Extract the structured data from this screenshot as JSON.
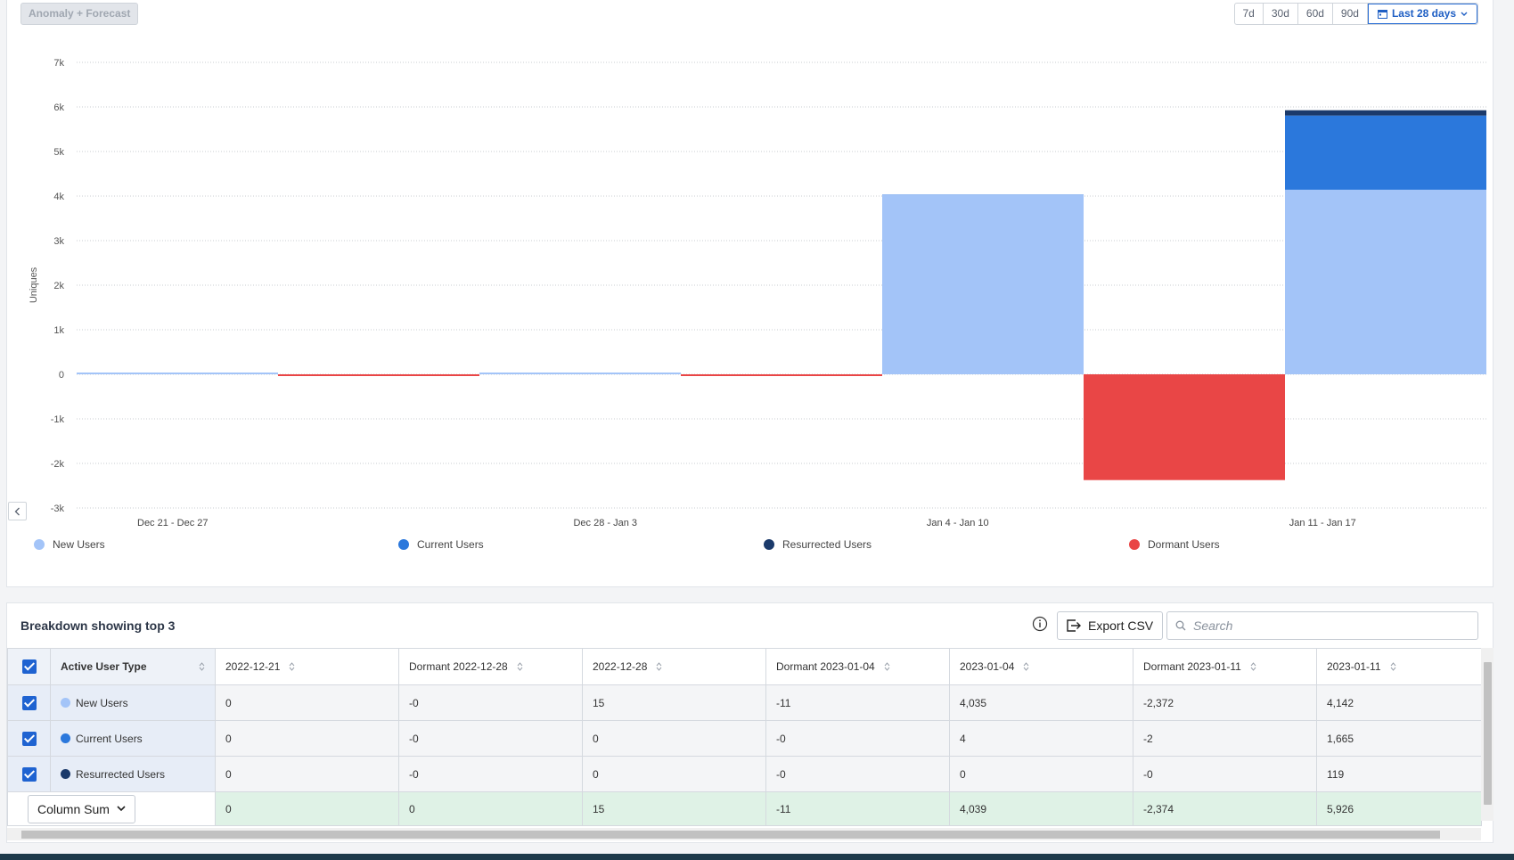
{
  "toolbar": {
    "anomaly_label": "Anomaly + Forecast",
    "ranges": [
      "7d",
      "30d",
      "60d",
      "90d"
    ],
    "active_range": "Last 28 days"
  },
  "chart_data": {
    "type": "bar",
    "stacked": true,
    "ylabel": "Uniques",
    "ylim": [
      -3000,
      7000
    ],
    "yticks": [
      7000,
      6000,
      5000,
      4000,
      3000,
      2000,
      1000,
      0,
      -1000,
      -2000,
      -3000
    ],
    "ytick_labels": [
      "7k",
      "6k",
      "5k",
      "4k",
      "3k",
      "2k",
      "1k",
      "0",
      "-1k",
      "-2k",
      "-3k"
    ],
    "grid": true,
    "legend_position": "bottom",
    "x_periods": [
      "Dec 21 - Dec 27",
      "Dec 28 - Jan 3",
      "Jan 4 - Jan 10",
      "Jan 11 - Jan 17"
    ],
    "bars": [
      {
        "period": 0,
        "dormant": false,
        "new": 0,
        "current": 0,
        "resurrected": 0
      },
      {
        "period": 0,
        "dormant": true,
        "value": 0
      },
      {
        "period": 1,
        "dormant": false,
        "new": 15,
        "current": 0,
        "resurrected": 0
      },
      {
        "period": 1,
        "dormant": true,
        "value": -11
      },
      {
        "period": 2,
        "dormant": false,
        "new": 4035,
        "current": 4,
        "resurrected": 0
      },
      {
        "period": 2,
        "dormant": true,
        "value": -2374
      },
      {
        "period": 3,
        "dormant": false,
        "new": 4142,
        "current": 1665,
        "resurrected": 119
      }
    ],
    "series": [
      {
        "name": "New Users",
        "color": "#a3c4f8"
      },
      {
        "name": "Current Users",
        "color": "#2b78dc"
      },
      {
        "name": "Resurrected Users",
        "color": "#1b3a6b"
      },
      {
        "name": "Dormant Users",
        "color": "#e94646"
      }
    ]
  },
  "breakdown": {
    "title": "Breakdown showing top 3",
    "export_label": "Export CSV",
    "search_placeholder": "Search",
    "first_col_header": "Active User Type",
    "columns": [
      "2022-12-21",
      "Dormant 2022-12-28",
      "2022-12-28",
      "Dormant 2023-01-04",
      "2023-01-04",
      "Dormant 2023-01-11",
      "2023-01-11"
    ],
    "rows": [
      {
        "label": "New Users",
        "color": "#a3c4f8",
        "values": [
          "0",
          "-0",
          "15",
          "-11",
          "4,035",
          "-2,372",
          "4,142"
        ]
      },
      {
        "label": "Current Users",
        "color": "#2b78dc",
        "values": [
          "0",
          "-0",
          "0",
          "-0",
          "4",
          "-2",
          "1,665"
        ]
      },
      {
        "label": "Resurrected Users",
        "color": "#1b3a6b",
        "values": [
          "0",
          "-0",
          "0",
          "-0",
          "0",
          "-0",
          "119"
        ]
      }
    ],
    "sum_label": "Column Sum",
    "sum_values": [
      "0",
      "0",
      "15",
      "-11",
      "4,039",
      "-2,374",
      "5,926"
    ]
  }
}
